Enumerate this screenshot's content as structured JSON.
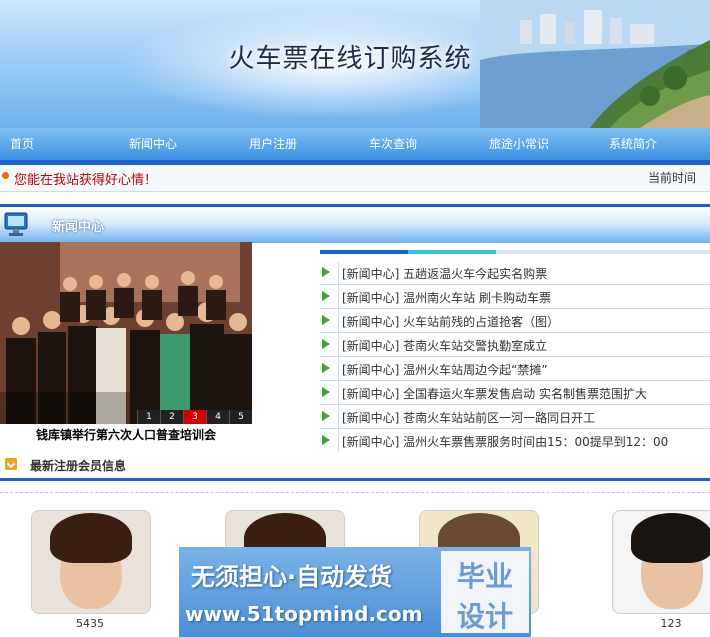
{
  "banner": {
    "title": "火车票在线订购系统"
  },
  "nav": {
    "items": [
      "首页",
      "新闻中心",
      "用户注册",
      "车次查询",
      "旅途小常识",
      "系统简介"
    ]
  },
  "notice": {
    "message": "您能在我站获得好心情！",
    "time_label": "当前时间"
  },
  "news": {
    "heading": "新闻中心",
    "photo_caption": "钱库镇举行第六次人口普查培训会",
    "pager": [
      "1",
      "2",
      "3",
      "4",
      "5"
    ],
    "pager_active": "3",
    "items": [
      "[新闻中心] 五趟返温火车今起实名购票",
      "[新闻中心] 温州南火车站 刷卡购动车票",
      "[新闻中心] 火车站前残的占道抢客（图）",
      "[新闻中心] 苍南火车站交警执勤室成立",
      "[新闻中心] 温州火车站周边今起“禁摊”",
      "[新闻中心] 全国春运火车票发售启动 实名制售票范围扩大",
      "[新闻中心] 苍南火车站站前区一河一路同日开工",
      "[新闻中心] 温州火车票售票服务时间由15：00提早到12：00"
    ]
  },
  "members": {
    "heading": "最新注册会员信息",
    "list": [
      {
        "name": "5435"
      },
      {
        "name": ""
      },
      {
        "name": ""
      },
      {
        "name": "123"
      }
    ]
  },
  "ad": {
    "slogan": "无须担心·自动发货",
    "url": "www.51topmind.com",
    "badge_top": "毕业",
    "badge_bottom": "设计"
  },
  "colors": {
    "nav_blue": "#3d8fe0",
    "accent_blue": "#1e62c7",
    "notice_red": "#c00000",
    "arrow_green": "#3fa33a"
  }
}
